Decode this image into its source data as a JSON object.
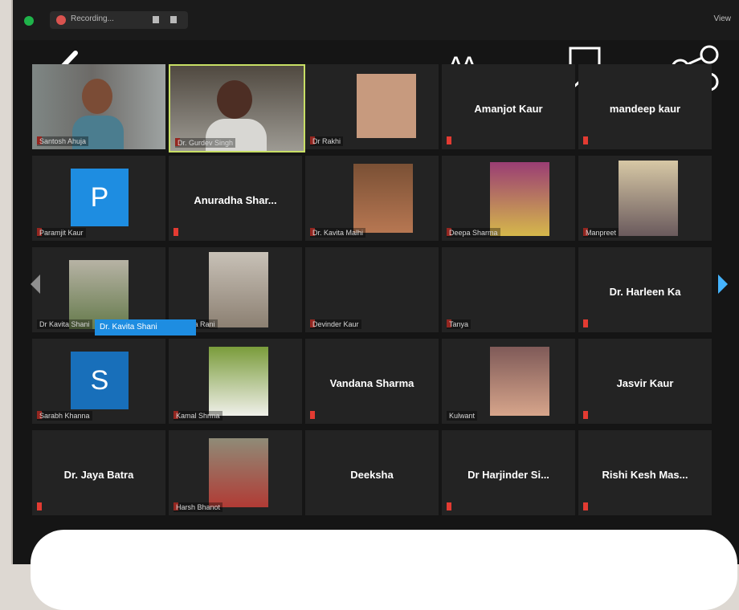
{
  "top_bar": {
    "recording_label": "Recording...",
    "view_label": "View"
  },
  "overlay_icons": [
    "back-icon",
    "text-size-icon",
    "bookmark-icon",
    "share-icon"
  ],
  "participants": [
    [
      "Santosh Ahuja",
      "Dr. Gurdev Singh",
      "Dr Rakhi",
      "Amanjot Kaur",
      "mandeep kaur"
    ],
    [
      "Paramjit Kaur",
      "Anuradha Shar...",
      "Dr. Kavita Malhi",
      "Deepa Sharma",
      "Manpreet"
    ],
    [
      "Dr Kavita Shani",
      "Meena Rani",
      "Devinder Kaur",
      "Tanya",
      "Dr. Harleen Ka"
    ],
    [
      "Sarabh Khanna",
      "Kamal Shrma",
      "Vandana Sharma",
      "Kulwant",
      "Jasvir Kaur"
    ],
    [
      "Dr. Jaya Batra",
      "Harsh Bhanot",
      "Deeksha",
      "Dr Harjinder Si...",
      "Rishi Kesh Mas..."
    ]
  ],
  "name_tiles": {
    "amanjot": "Amanjot Kaur",
    "mandeep": "mandeep kaur",
    "anuradha": "Anuradha  Shar...",
    "harleen": "Dr. Harleen Ka",
    "vandana": "Vandana Sharma",
    "jasvir": "Jasvir Kaur",
    "jaya": "Dr. Jaya Batra",
    "deeksha": "Deeksha",
    "harjinder": "Dr Harjinder Si...",
    "rishi": "Rishi Kesh Mas..."
  },
  "avatars": {
    "p": "P",
    "s": "S"
  },
  "raised_hand_label": "Dr. Kavita Shani"
}
